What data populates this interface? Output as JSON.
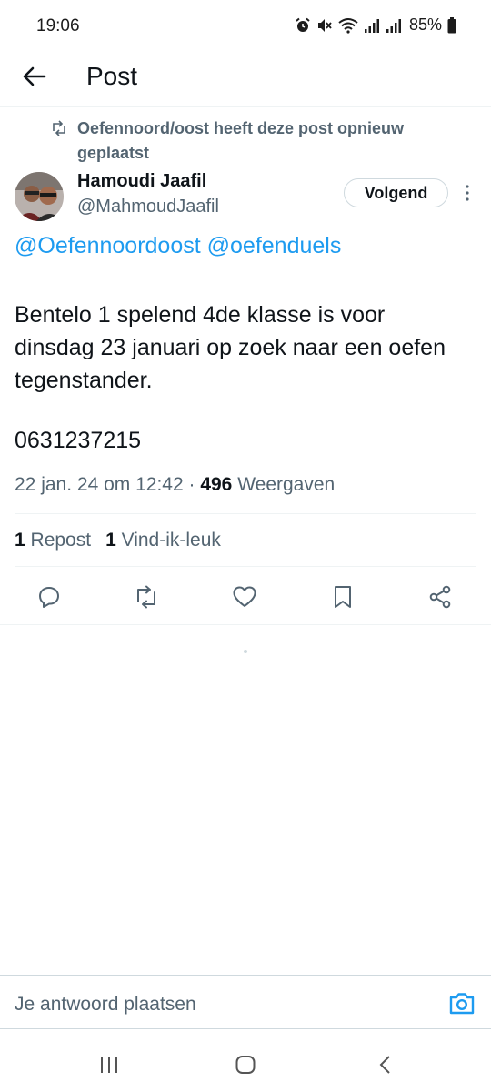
{
  "status_bar": {
    "time": "19:06",
    "battery": "85%",
    "icons": [
      "alarm-icon",
      "mute-icon",
      "wifi-icon",
      "signal-icon",
      "signal-icon",
      "battery-icon"
    ]
  },
  "header": {
    "title": "Post",
    "back_icon": "arrow-left-icon"
  },
  "repost": {
    "text": "Oefennoord/oost heeft deze post opnieuw geplaatst"
  },
  "author": {
    "name": "Hamoudi Jaafil",
    "handle": "@MahmoudJaafil",
    "follow_label": "Volgend"
  },
  "post": {
    "mention1": "@Oefennoordoost",
    "mention2": "@oefenduels",
    "text": "Bentelo 1 spelend 4de klasse is voor dinsdag 23 januari op zoek naar een oefen tegenstander.",
    "phone": "0631237215",
    "datetime": "22 jan. 24 om 12:42 · ",
    "views_count": "496",
    "views_label": " Weergaven"
  },
  "stats": {
    "repost_count": "1",
    "repost_label": " Repost",
    "like_count": "1",
    "like_label": " Vind-ik-leuk"
  },
  "actions": [
    "reply-icon",
    "repost-icon",
    "like-icon",
    "bookmark-icon",
    "share-icon"
  ],
  "reply_bar": {
    "placeholder": "Je antwoord plaatsen"
  },
  "colors": {
    "accent": "#1d9bf0",
    "text_primary": "#0f1419",
    "text_secondary": "#536471",
    "divider": "#eff3f4"
  }
}
